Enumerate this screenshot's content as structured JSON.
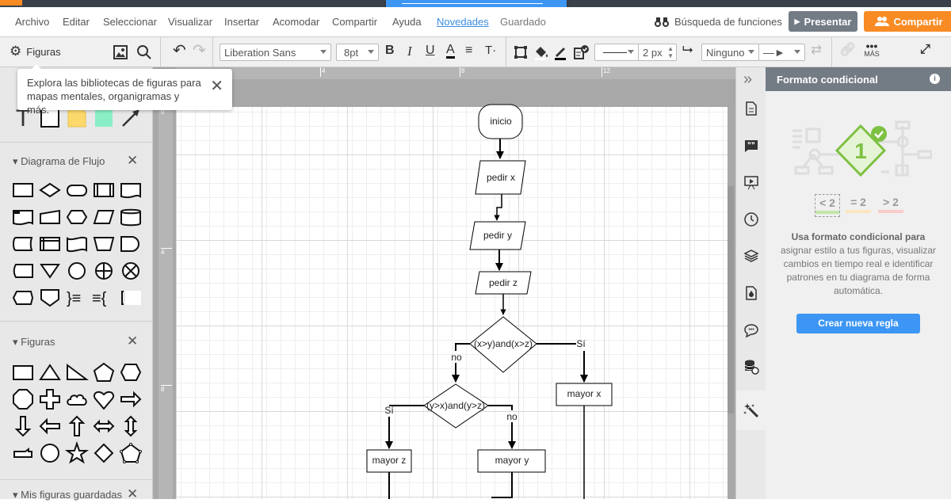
{
  "menu": {
    "items": [
      "Archivo",
      "Editar",
      "Seleccionar",
      "Visualizar",
      "Insertar",
      "Acomodar",
      "Compartir",
      "Ayuda"
    ],
    "novedades": "Novedades",
    "status": "Guardado",
    "feature_search": "Búsqueda de funciones",
    "present": "Presentar",
    "share": "Compartir"
  },
  "toolbar": {
    "shapes_label": "Figuras",
    "font": "Liberation Sans",
    "font_size": "8pt",
    "line_width": "2 px",
    "endpoint_start": "Ninguno",
    "more": "MÁS"
  },
  "tooltip": {
    "text": "Explora las bibliotecas de figuras para mapas mentales, organigramas y más."
  },
  "left_panel": {
    "sections": [
      {
        "title": "Diagrama de Flujo"
      },
      {
        "title": "Figuras"
      },
      {
        "title": "Mis figuras guardadas"
      }
    ]
  },
  "rulers": {
    "h": [
      "4",
      "8",
      "12"
    ],
    "v": [
      "0",
      "4",
      "8"
    ]
  },
  "diagram": {
    "start": "inicio",
    "in1": "pedir x",
    "in2": "pedir y",
    "in3": "pedir z",
    "cond1": "(x>y)and(x>z)",
    "cond2": "(y>x)and(y>z)",
    "yes": "Sí",
    "no": "no",
    "out_x": "mayor x",
    "out_y": "mayor y",
    "out_z": "mayor z"
  },
  "right_panel": {
    "title": "Formato condicional",
    "conds": [
      "< 2",
      "= 2",
      "> 2"
    ],
    "badge": "1",
    "desc_bold": "Usa formato condicional para",
    "desc": "asignar estilo a tus figuras, visualizar cambios en tiempo real e identificar patrones en tu diagrama de forma automática.",
    "button": "Crear nueva regla"
  },
  "colors": {
    "accent_orange": "#f98b24",
    "accent_blue": "#3d96f4",
    "header_gray": "#737b85",
    "green": "#7dc142"
  }
}
